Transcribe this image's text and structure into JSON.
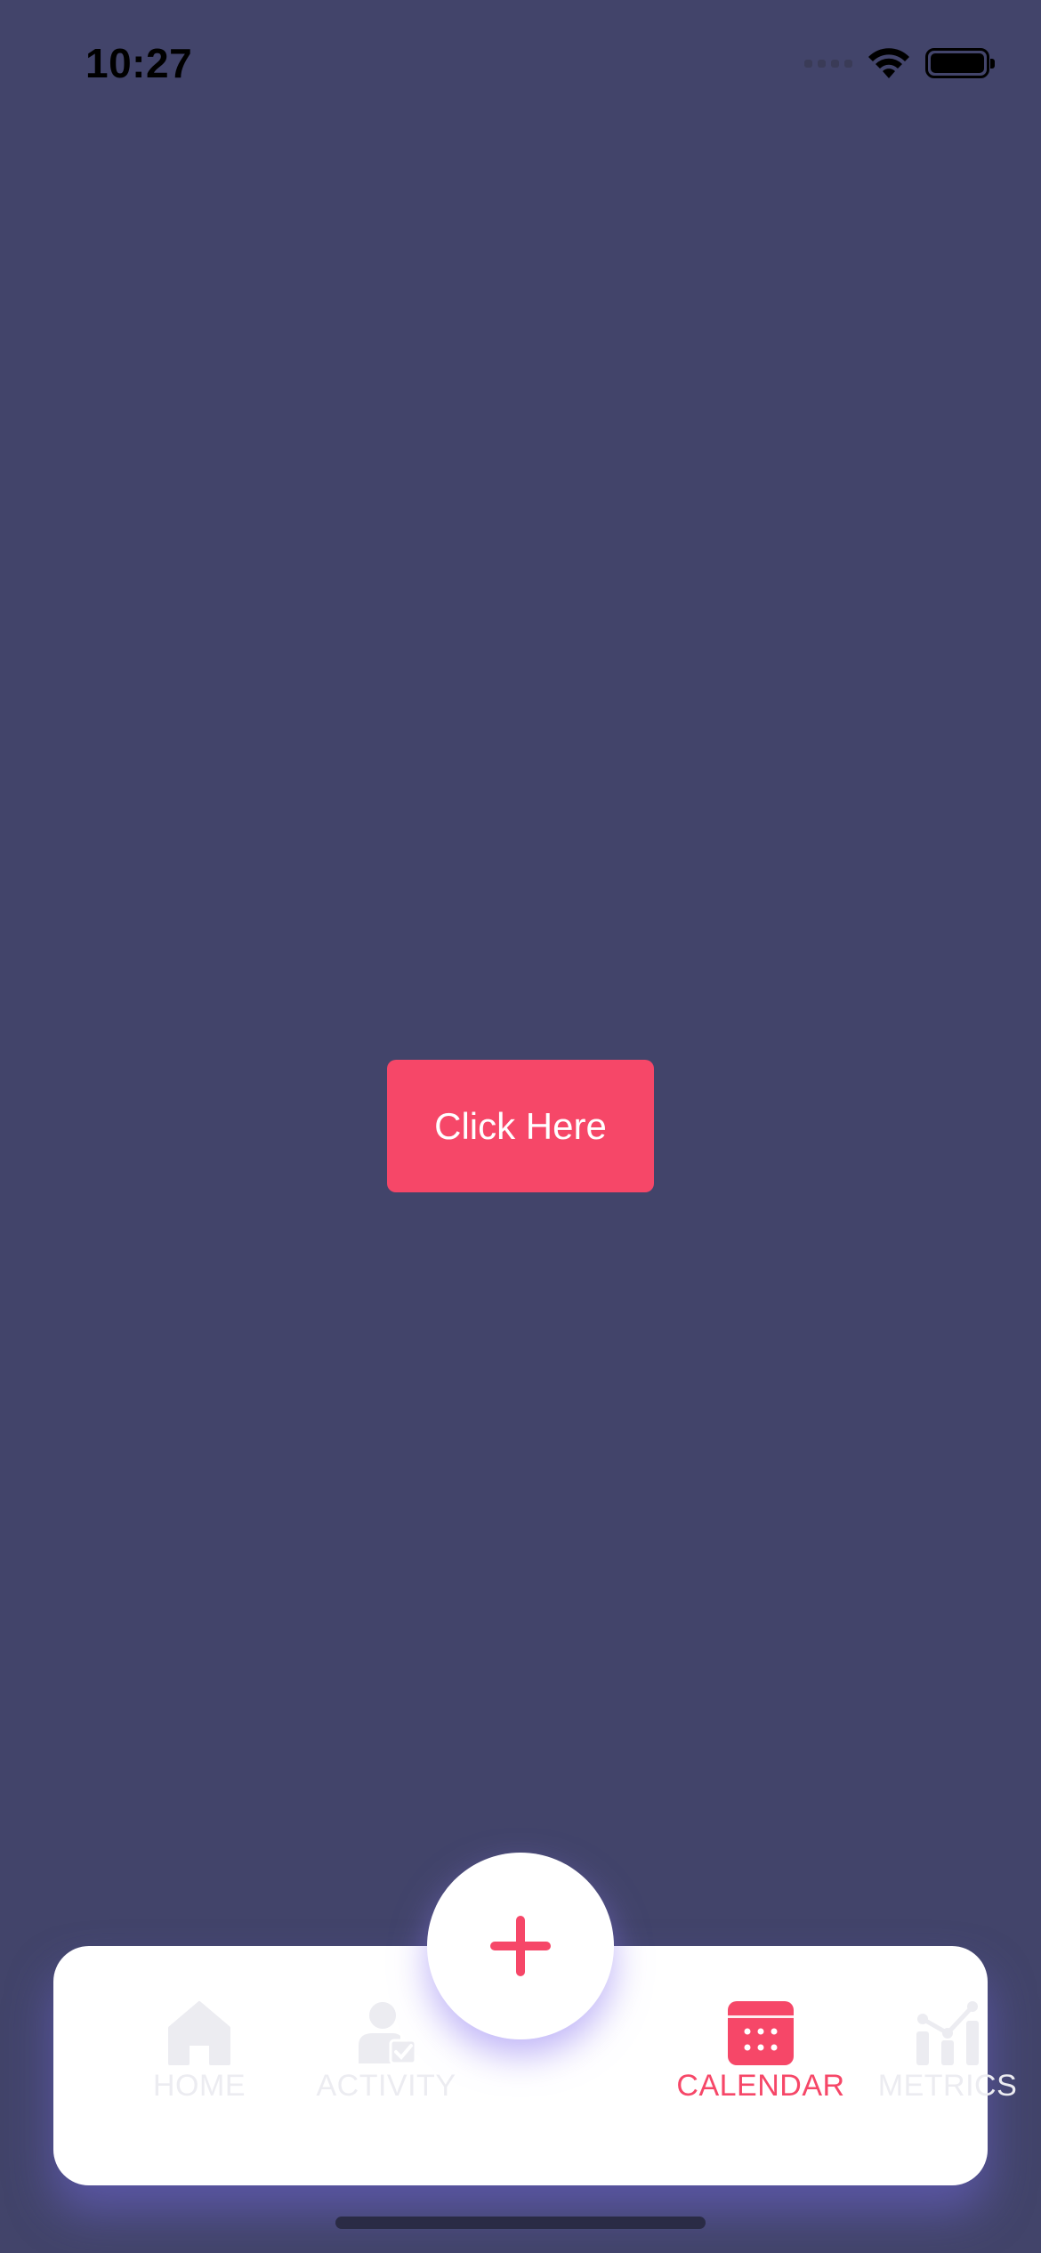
{
  "status_bar": {
    "time": "10:27"
  },
  "main": {
    "button_label": "Click Here"
  },
  "tab_bar": {
    "tabs": [
      {
        "label": "HOME",
        "icon": "home-icon",
        "active": false
      },
      {
        "label": "ACTIVITY",
        "icon": "activity-icon",
        "active": false
      },
      {
        "label": "CALENDAR",
        "icon": "calendar-icon",
        "active": true
      },
      {
        "label": "METRICS",
        "icon": "metrics-icon",
        "active": false
      }
    ],
    "center_action": {
      "icon": "plus-icon"
    }
  },
  "colors": {
    "background": "#42446a",
    "accent": "#f64768",
    "inactive_tab": "#ececf1",
    "surface": "#ffffff"
  }
}
